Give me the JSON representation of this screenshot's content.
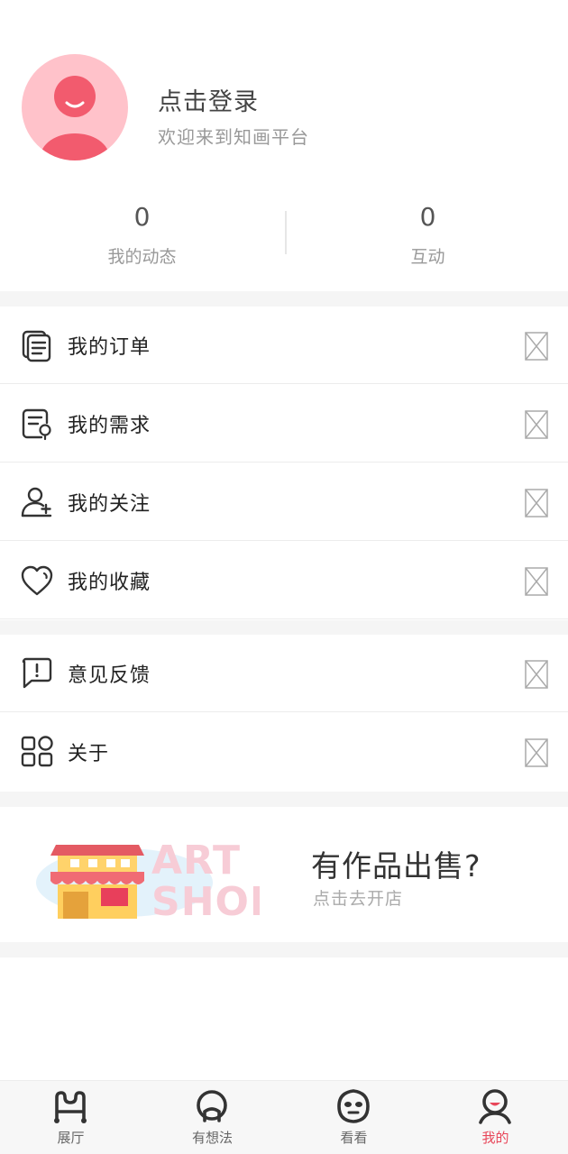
{
  "profile": {
    "title": "点击登录",
    "subtitle": "欢迎来到知画平台"
  },
  "stats": [
    {
      "value": "0",
      "label": "我的动态"
    },
    {
      "value": "0",
      "label": "互动"
    }
  ],
  "menu_group_1": [
    {
      "label": "我的订单",
      "icon": "orders-icon"
    },
    {
      "label": "我的需求",
      "icon": "requirements-icon"
    },
    {
      "label": "我的关注",
      "icon": "follow-user-icon"
    },
    {
      "label": "我的收藏",
      "icon": "heart-icon"
    }
  ],
  "menu_group_2": [
    {
      "label": "意见反馈",
      "icon": "feedback-icon"
    },
    {
      "label": "关于",
      "icon": "apps-icon"
    }
  ],
  "promo": {
    "title": "有作品出售?",
    "subtitle": "点击去开店",
    "image_text": "ART SHOP"
  },
  "tabbar": [
    {
      "label": "展厅",
      "icon": "gallery-icon",
      "active": false
    },
    {
      "label": "有想法",
      "icon": "idea-icon",
      "active": false
    },
    {
      "label": "看看",
      "icon": "look-icon",
      "active": false
    },
    {
      "label": "我的",
      "icon": "me-icon",
      "active": true
    }
  ],
  "colors": {
    "accent": "#e8475a",
    "avatar_bg": "#ffc2ca",
    "divider": "#f5f5f5"
  }
}
